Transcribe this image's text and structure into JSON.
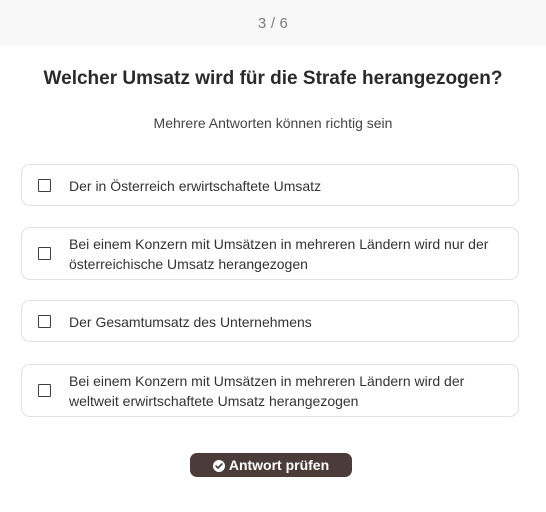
{
  "progress": {
    "text": "3 / 6"
  },
  "question": {
    "title": "Welcher Umsatz wird für die Strafe herangezogen?",
    "hint": "Mehrere Antworten können richtig sein"
  },
  "options": [
    {
      "label": "Der in Österreich erwirtschaftete Umsatz",
      "checked": false
    },
    {
      "label": "Bei einem Konzern mit Umsätzen in mehreren Ländern wird nur der österreichische Umsatz herangezogen",
      "checked": false
    },
    {
      "label": "Der Gesamtumsatz des Unternehmens",
      "checked": false
    },
    {
      "label": "Bei einem Konzern mit Umsätzen in mehreren Ländern wird der weltweit erwirtschaftete Umsatz herangezogen",
      "checked": false
    }
  ],
  "actions": {
    "submit_label": "Antwort prüfen"
  },
  "icons": {
    "submit": "check-circle-icon",
    "option_box": "checkbox-icon"
  },
  "colors": {
    "button_background": "#4b3c39",
    "card_border": "#e1e1e1",
    "progress_text": "#7d7d7d"
  }
}
